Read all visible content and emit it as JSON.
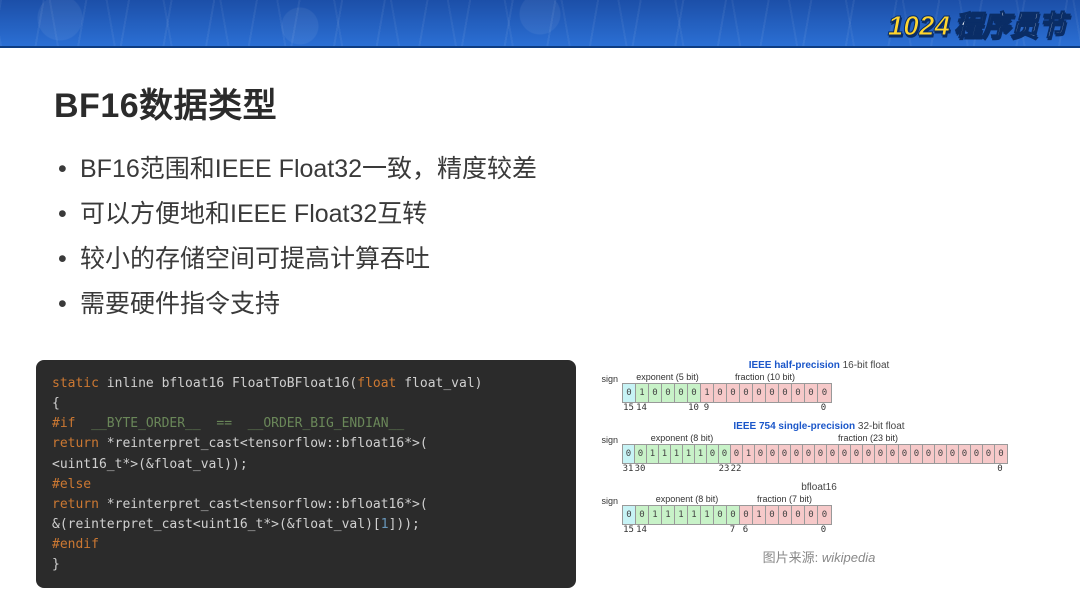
{
  "banner": {
    "logo_year": "1024",
    "logo_cn": "程序员节"
  },
  "title": "BF16数据类型",
  "bullets": [
    "BF16范围和IEEE Float32一致，精度较差",
    "可以方便地和IEEE Float32互转",
    "较小的存储空间可提高计算吞吐",
    "需要硬件指令支持"
  ],
  "code": {
    "l1a": "static",
    "l1b": " inline bfloat16 FloatToBFloat16(",
    "l1c": "float",
    "l1d": " float_val)",
    "l2": "{",
    "l3a": "#if",
    "l3b": "  __BYTE_ORDER__  ==  __ORDER_BIG_ENDIAN__",
    "l4a": "return",
    "l4b": " *reinterpret_cast<tensorflow::bfloat16*>(",
    "l5": "<uint16_t*>(&float_val));",
    "l6": "#else",
    "l7a": "return",
    "l7b": " *reinterpret_cast<tensorflow::bfloat16*>(",
    "l8a": "&(reinterpret_cast<uint16_t*>(&float_val)[",
    "l8b": "1",
    "l8c": "]));",
    "l9": "#endif",
    "l10": "}"
  },
  "figs": {
    "fp16": {
      "title_bold": "IEEE half-precision",
      "title_rest": " 16-bit float",
      "sign_label": "sign",
      "exp_label": "exponent (5 bit)",
      "frac_label": "fraction (10 bit)",
      "bits": "0100001000000000",
      "ticks": [
        "15",
        "14",
        "10",
        "9",
        "0"
      ]
    },
    "fp32": {
      "title_bold": "IEEE 754 single-precision",
      "title_rest": " 32-bit float",
      "sign_label": "sign",
      "exp_label": "exponent (8 bit)",
      "frac_label": "fraction (23 bit)",
      "bits": "00111110001000000000000000000000",
      "ticks": [
        "31",
        "30",
        "23",
        "22",
        "0"
      ]
    },
    "bf16": {
      "title_bold": "",
      "title_rest": "bfloat16",
      "sign_label": "sign",
      "exp_label": "exponent (8 bit)",
      "frac_label": "fraction (7 bit)",
      "bits": "0011111000100000",
      "ticks": [
        "15",
        "14",
        "7",
        "6",
        "0"
      ]
    },
    "credit_prefix": "图片来源: ",
    "credit_src": "wikipedia"
  }
}
